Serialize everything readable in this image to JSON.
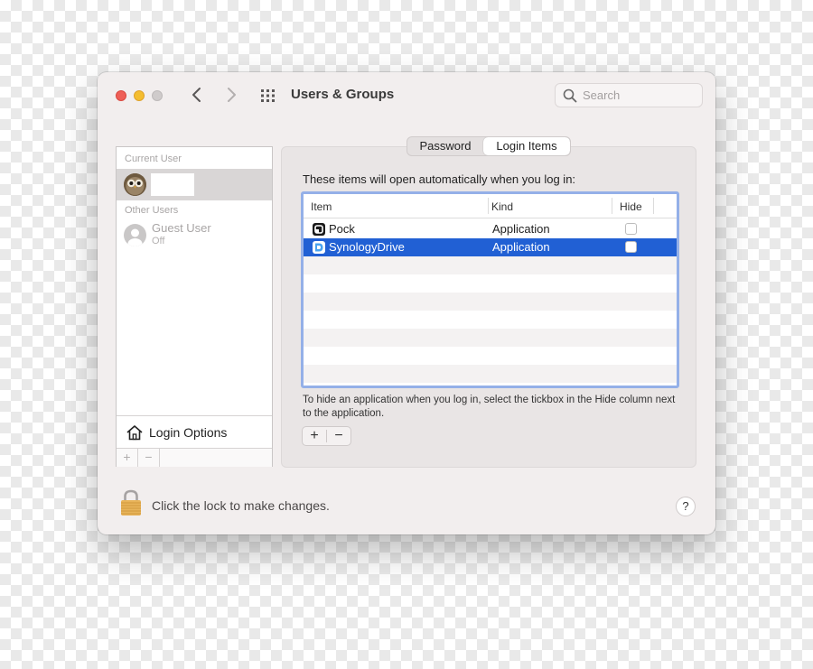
{
  "window": {
    "title": "Users & Groups",
    "search_placeholder": "Search"
  },
  "sidebar": {
    "current_user_label": "Current User",
    "other_users_label": "Other Users",
    "guest_name": "Guest User",
    "guest_status": "Off",
    "login_options_label": "Login Options",
    "add_symbol": "+",
    "remove_symbol": "−"
  },
  "tabs": [
    {
      "label": "Password",
      "selected": false
    },
    {
      "label": "Login Items",
      "selected": true
    }
  ],
  "login_items": {
    "intro": "These items will open automatically when you log in:",
    "columns": [
      "Item",
      "Kind",
      "Hide"
    ],
    "rows": [
      {
        "item": "Pock",
        "kind": "Application",
        "hide": false,
        "selected": false,
        "icon": "pock-icon"
      },
      {
        "item": "SynologyDrive",
        "kind": "Application",
        "hide": false,
        "selected": true,
        "icon": "synology-drive-icon"
      }
    ],
    "help_text": "To hide an application when you log in, select the tickbox in the Hide column next to the application.",
    "add_symbol": "+",
    "remove_symbol": "−"
  },
  "footer": {
    "lock_text": "Click the lock to make changes.",
    "help_symbol": "?"
  },
  "colors": {
    "accent_selection": "#2160d4",
    "table_focus_ring": "#94b0e8",
    "window_bg": "#f2eeee"
  }
}
